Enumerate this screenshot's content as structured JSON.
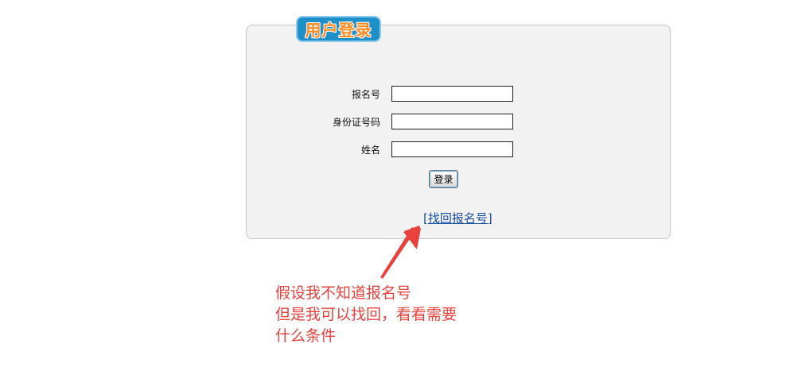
{
  "login": {
    "title": "用户登录",
    "fields": [
      {
        "label": "报名号",
        "value": ""
      },
      {
        "label": "身份证号码",
        "value": ""
      },
      {
        "label": "姓名",
        "value": ""
      }
    ],
    "submit_label": "登录",
    "recover_link": "[找回报名号]"
  },
  "annotation": {
    "lines": [
      "假设我不知道报名号",
      "但是我可以找回，看看需要",
      "什么条件"
    ],
    "color": "#e8423f"
  },
  "colors": {
    "badge": "#1f8fc7",
    "badge_text": "#ff8a1f",
    "panel": "#f2f2f2",
    "link": "#1a4fa0"
  }
}
